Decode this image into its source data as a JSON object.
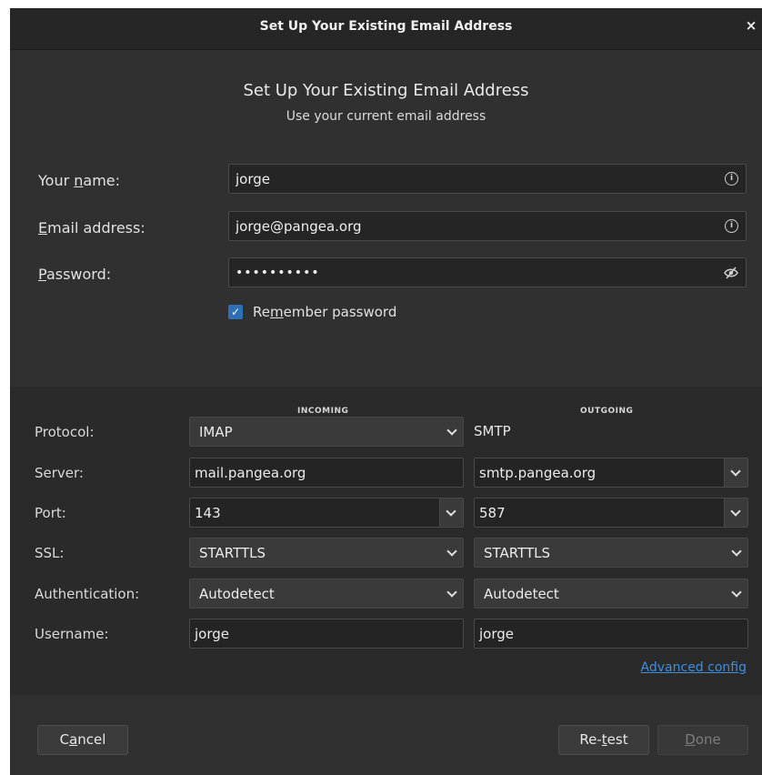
{
  "window": {
    "title": "Set Up Your Existing Email Address",
    "close_glyph": "×"
  },
  "header": {
    "heading": "Set Up Your Existing Email Address",
    "subheading": "Use your current email address"
  },
  "form": {
    "name": {
      "label_pre": "Your ",
      "label_accel": "n",
      "label_post": "ame:",
      "value": "jorge"
    },
    "email": {
      "label_pre": "",
      "label_accel": "E",
      "label_post": "mail address:",
      "value": "jorge@pangea.org"
    },
    "password": {
      "label_pre": "",
      "label_accel": "P",
      "label_post": "assword:",
      "value": "••••••••••"
    },
    "remember": {
      "label_pre": "Re",
      "label_accel": "m",
      "label_post": "ember password",
      "checked": true
    }
  },
  "server": {
    "incoming_header": "INCOMING",
    "outgoing_header": "OUTGOING",
    "labels": {
      "protocol": "Protocol:",
      "server": "Server:",
      "port": "Port:",
      "ssl": "SSL:",
      "authentication": "Authentication:",
      "username": "Username:"
    },
    "incoming": {
      "protocol": "IMAP",
      "server": "mail.pangea.org",
      "port": "143",
      "ssl": "STARTTLS",
      "authentication": "Autodetect",
      "username": "jorge"
    },
    "outgoing": {
      "protocol": "SMTP",
      "server": "smtp.pangea.org",
      "port": "587",
      "ssl": "STARTTLS",
      "authentication": "Autodetect",
      "username": "jorge"
    },
    "advanced": {
      "accel": "A",
      "rest": "dvanced config"
    }
  },
  "buttons": {
    "cancel": {
      "pre": "C",
      "accel": "a",
      "post": "ncel"
    },
    "retest": {
      "pre": "Re-",
      "accel": "t",
      "post": "est"
    },
    "done": {
      "pre": "",
      "accel": "D",
      "post": "one"
    }
  },
  "colors": {
    "accent": "#2f6fb5",
    "link": "#3d8ee0",
    "dialog_bg": "#303030",
    "panel_bg": "#2a2a2a"
  },
  "icons": [
    "close-icon",
    "info-icon",
    "eye-slash-icon",
    "checkmark-icon",
    "chevron-down-icon"
  ]
}
